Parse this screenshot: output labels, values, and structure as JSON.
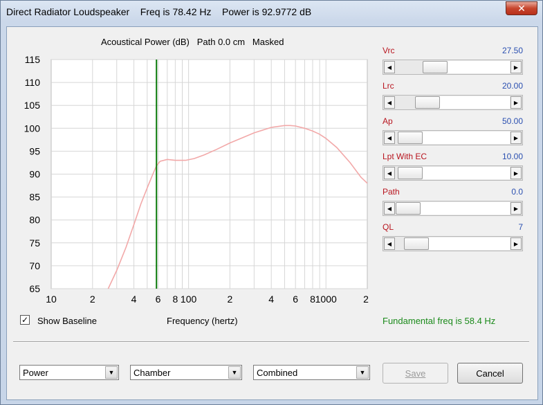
{
  "window": {
    "title": "Direct Radiator Loudspeaker    Freq is 78.42 Hz    Power is 92.9772 dB",
    "close_glyph": "✕"
  },
  "chart": {
    "title": "Acoustical Power (dB)   Path 0.0 cm   Masked"
  },
  "chart_data": {
    "type": "line",
    "title": "Acoustical Power (dB)   Path 0.0 cm   Masked",
    "xlabel": "Frequency (hertz)",
    "ylabel": "",
    "x_scale": "log",
    "xlim": [
      10,
      2000
    ],
    "ylim": [
      65,
      115
    ],
    "y_ticks": [
      65,
      70,
      75,
      80,
      85,
      90,
      95,
      100,
      105,
      110,
      115
    ],
    "y_tick_labels": [
      "65",
      "70",
      "75",
      "80",
      "85",
      "90",
      "95",
      "100",
      "105",
      "110",
      "115"
    ],
    "x_tick_values": [
      10,
      20,
      40,
      60,
      80,
      100,
      200,
      400,
      600,
      800,
      1000,
      2000
    ],
    "x_tick_labels": [
      "10",
      "2",
      "4",
      "6",
      "8",
      "100",
      "2",
      "4",
      "6",
      "8",
      "1000",
      "2"
    ],
    "grid": true,
    "marker_x": 58.4,
    "marker_color": "#0a7a0a",
    "line_color": "#f2a8a8",
    "series": [
      {
        "x": [
          26,
          30,
          35,
          40,
          45,
          50,
          55,
          58.4,
          62,
          70,
          80,
          95,
          110,
          130,
          160,
          200,
          250,
          300,
          400,
          500,
          550,
          600,
          700,
          800,
          900,
          1000,
          1200,
          1500,
          1800,
          2000
        ],
        "values": [
          65.0,
          69.0,
          74.0,
          79.0,
          83.5,
          87.0,
          90.0,
          91.8,
          92.8,
          93.2,
          93.0,
          93.0,
          93.4,
          94.2,
          95.4,
          96.8,
          98.0,
          99.0,
          100.2,
          100.6,
          100.6,
          100.5,
          100.0,
          99.4,
          98.7,
          97.8,
          95.8,
          92.5,
          89.3,
          88.0
        ]
      }
    ]
  },
  "sliders": [
    {
      "label": "Vrc",
      "value": "27.50"
    },
    {
      "label": "Lrc",
      "value": "20.00"
    },
    {
      "label": "Ap",
      "value": "50.00"
    },
    {
      "label": "Lpt With EC",
      "value": "10.00"
    },
    {
      "label": "Path",
      "value": "0.0"
    },
    {
      "label": "QL",
      "value": "7"
    }
  ],
  "slider_positions": [
    0.3,
    0.22,
    0.02,
    0.02,
    0.0,
    0.09
  ],
  "controls": {
    "show_baseline_label": "Show Baseline",
    "show_baseline_checked": "✓",
    "xlabel": "Frequency (hertz)",
    "fundamental": "Fundamental freq is 58.4 Hz",
    "dropdown1": "Power",
    "dropdown2": "Chamber",
    "dropdown3": "Combined",
    "save_label": "Save",
    "cancel_label": "Cancel"
  }
}
